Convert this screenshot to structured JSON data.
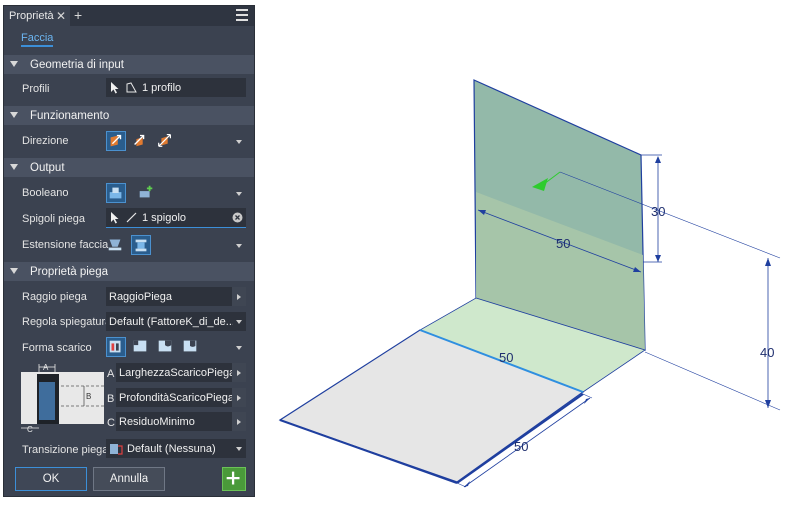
{
  "panel": {
    "tab_title": "Proprietà",
    "close_glyph": "✕",
    "add_glyph": "+",
    "subtab": "Faccia"
  },
  "sections": {
    "input": "Geometria di input",
    "behavior": "Funzionamento",
    "output": "Output",
    "bend": "Proprietà piega"
  },
  "fields": {
    "profiles_label": "Profili",
    "profiles_value": "1 profilo",
    "direction_label": "Direzione",
    "boolean_label": "Booleano",
    "bend_edges_label": "Spigoli piega",
    "bend_edges_value": "1 spigolo",
    "face_extent_label": "Estensione faccia",
    "bend_radius_label": "Raggio piega",
    "bend_radius_value": "RaggioPiega",
    "unfold_rule_label": "Regola spiegatura",
    "unfold_rule_value": "Default (FattoreK_di_de...",
    "relief_shape_label": "Forma scarico",
    "a_label": "A",
    "a_value": "LarghezzaScaricoPiega",
    "b_label": "B",
    "b_value": "ProfonditàScaricoPiega",
    "c_label": "C",
    "c_value": "ResiduoMinimo",
    "diag_a": "A",
    "diag_b": "B",
    "diag_c": "C",
    "transition_label": "Transizione piega",
    "transition_value": "Default (Nessuna)"
  },
  "buttons": {
    "ok": "OK",
    "cancel": "Annulla"
  },
  "dimensions": {
    "d30": "30",
    "d50_top": "50",
    "d40": "40",
    "d50_mid": "50",
    "d50_bottom": "50"
  },
  "colors": {
    "accent": "#3c8fd8",
    "panel_bg": "#3b4250",
    "face_green": "#8fb8a4",
    "face_light_green": "#cfe8cc",
    "base_grey": "#e6e6e6",
    "edge_blue": "#1f3f9f",
    "add_green": "#4a9a3a"
  }
}
